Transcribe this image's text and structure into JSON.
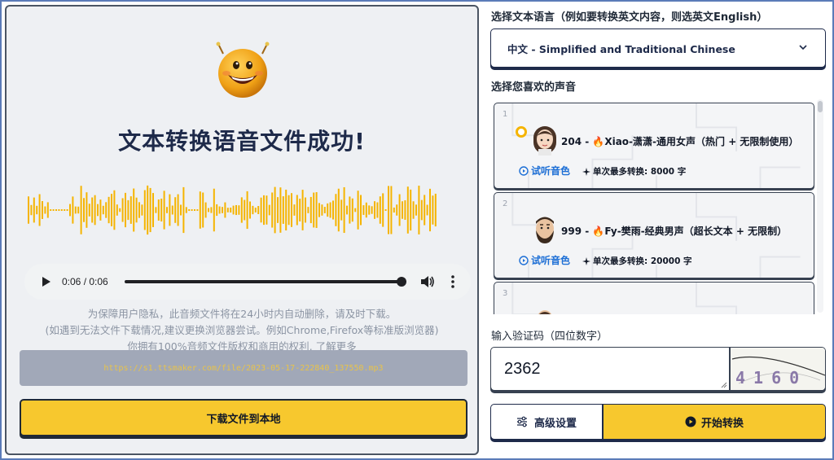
{
  "result": {
    "title": "文本转换语音文件成功!",
    "audio_time": "0:06 / 0:06",
    "notice_line1": "为保障用户隐私，此音频文件将在24小时内自动删除，请及时下载。",
    "notice_line2": "(如遇到无法文件下载情况,建议更换浏览器尝试。例如Chrome,Firefox等标准版浏览器)",
    "notice_link": "你拥有100%音频文件版权和商用的权利, 了解更多",
    "file_url": "https://s1.ttsmaker.com/file/2023-05-17-222840_137550.mp3",
    "download_label": "下载文件到本地"
  },
  "language": {
    "label": "选择文本语言（例如要转换英文内容，则选英文English）",
    "selected": "中文 - Simplified and Traditional Chinese"
  },
  "voices": {
    "label": "选择您喜欢的声音",
    "items": [
      {
        "index": "1",
        "id": "204 - ",
        "fire": "🔥",
        "name": "Xiao-潇潇-通用女声（热门 + 无限制使用）",
        "listen": "试听音色",
        "max_chars": "单次最多转换: 8000 字",
        "selected": true
      },
      {
        "index": "2",
        "id": "999 - ",
        "fire": "🔥",
        "name": "Fy-樊雨-经典男声（超长文本 + 无限制）",
        "listen": "试听音色",
        "max_chars": "单次最多转换: 20000 字",
        "selected": false
      },
      {
        "index": "3",
        "id": "",
        "fire": "",
        "name": "",
        "listen": "",
        "max_chars": "",
        "selected": false
      }
    ]
  },
  "captcha": {
    "label": "输入验证码（四位数字）",
    "value": "2362",
    "image_text": "4160"
  },
  "actions": {
    "advanced_label": "高级设置",
    "start_label": "开始转换"
  },
  "colors": {
    "accent_yellow": "#f7c82e",
    "navy": "#1e2a4a",
    "link_blue": "#1d6fd6",
    "wave": "#f5b400"
  }
}
